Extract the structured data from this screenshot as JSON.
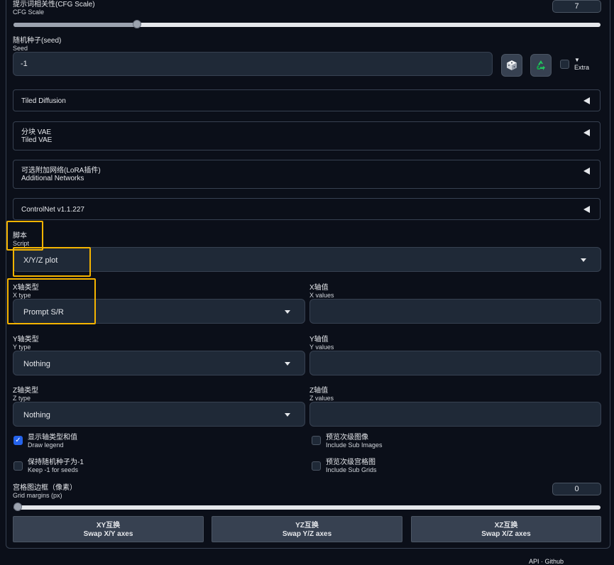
{
  "cfg": {
    "zh": "提示词相关性(CFG Scale)",
    "en": "CFG Scale",
    "value": "7",
    "slider_fraction": 0.2
  },
  "seed": {
    "zh": "随机种子(seed)",
    "en": "Seed",
    "value": "-1",
    "extra_label": "Extra"
  },
  "accordions": {
    "tiled_diffusion": "Tiled Diffusion",
    "tiled_vae_zh": "分块 VAE",
    "tiled_vae_en": "Tiled VAE",
    "addnet_zh": "可选附加网络(LoRA插件)",
    "addnet_en": "Additional Networks",
    "controlnet": "ControlNet v1.1.227"
  },
  "script": {
    "zh": "脚本",
    "en": "Script",
    "value": "X/Y/Z plot"
  },
  "xtype": {
    "zh": "X轴类型",
    "en": "X type",
    "value": "Prompt S/R"
  },
  "xvalues": {
    "zh": "X轴值",
    "en": "X values"
  },
  "ytype": {
    "zh": "Y轴类型",
    "en": "Y type",
    "value": "Nothing"
  },
  "yvalues": {
    "zh": "Y轴值",
    "en": "Y values"
  },
  "ztype": {
    "zh": "Z轴类型",
    "en": "Z type",
    "value": "Nothing"
  },
  "zvalues": {
    "zh": "Z轴值",
    "en": "Z values"
  },
  "checkboxes": {
    "draw_legend": {
      "zh": "显示轴类型和值",
      "en": "Draw legend",
      "checked": true
    },
    "include_sub_images": {
      "zh": "预览次级图像",
      "en": "Include Sub Images",
      "checked": false
    },
    "keep_seeds": {
      "zh": "保持随机种子为-1",
      "en": "Keep -1 for seeds",
      "checked": false
    },
    "include_sub_grids": {
      "zh": "预览次级宫格图",
      "en": "Include Sub Grids",
      "checked": false
    }
  },
  "grid_margins": {
    "zh": "宫格图边框（像素）",
    "en": "Grid margins (px)",
    "value": "0",
    "slider_fraction": 0.0
  },
  "swap": {
    "xy_zh": "XY互换",
    "xy_en": "Swap X/Y axes",
    "yz_zh": "YZ互换",
    "yz_en": "Swap Y/Z axes",
    "xz_zh": "XZ互换",
    "xz_en": "Swap X/Z axes"
  },
  "footer": "API · Github"
}
